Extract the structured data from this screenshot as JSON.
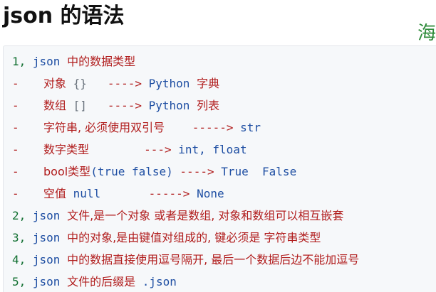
{
  "title": "json 的语法",
  "watermark": "海",
  "lines": [
    {
      "num": "1,",
      "code1": "json",
      "text1": "中的数据类型"
    },
    {
      "dash": "-",
      "cn1": "对象",
      "code1": "{}",
      "arrow": "---->",
      "code2": "Python",
      "cn2": "字典"
    },
    {
      "dash": "-",
      "cn1": "数组",
      "code1": "[]",
      "arrow": "---->",
      "code2": "Python",
      "cn2": "列表"
    },
    {
      "dash": "-",
      "cn1": "字符串, 必须使用双引号",
      "arrow": "----->",
      "code2": "str"
    },
    {
      "dash": "-",
      "cn1": "数字类型",
      "arrow": "--->",
      "code2": "int, float"
    },
    {
      "dash": "-",
      "cn1a": "bool类型",
      "code1": "(true false)",
      "arrow": "---->",
      "code2": "True  False"
    },
    {
      "dash": "-",
      "cn1": "空值",
      "code1": "null",
      "arrow": "----->",
      "code2": "None"
    },
    {
      "num": "2,",
      "code1": "json",
      "text1": "文件,是一个对象 或者是数组, 对象和数组可以相互嵌套"
    },
    {
      "num": "3,",
      "code1": "json",
      "text1": "中的对象,是由键值对组成的, 键必须是 字符串类型"
    },
    {
      "num": "4,",
      "code1": "json",
      "text1": "中的数据直接使用逗号隔开, 最后一个数据后边不能加逗号"
    },
    {
      "num": "5,",
      "code1": "json",
      "text1": "文件的后缀是",
      "code2": ".json"
    }
  ]
}
